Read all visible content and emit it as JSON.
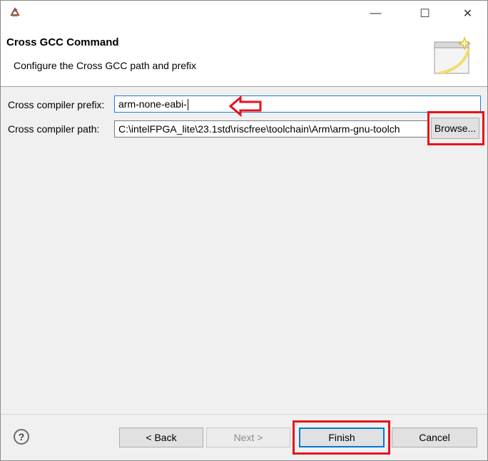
{
  "window": {
    "title": "",
    "controls": {
      "minimize": "—",
      "maximize": "☐",
      "close": "✕"
    }
  },
  "header": {
    "title": "Cross GCC Command",
    "description": "Configure the Cross GCC path and prefix"
  },
  "form": {
    "prefix_label": "Cross compiler prefix:",
    "prefix_value": "arm-none-eabi-",
    "path_label": "Cross compiler path:",
    "path_value": "C:\\intelFPGA_lite\\23.1std\\riscfree\\toolchain\\Arm\\arm-gnu-toolch",
    "browse_label": "Browse..."
  },
  "footer": {
    "help": "?",
    "back": "< Back",
    "next": "Next >",
    "finish": "Finish",
    "cancel": "Cancel"
  },
  "colors": {
    "annotation_red": "#e8111b",
    "focus_blue": "#0078d7"
  }
}
